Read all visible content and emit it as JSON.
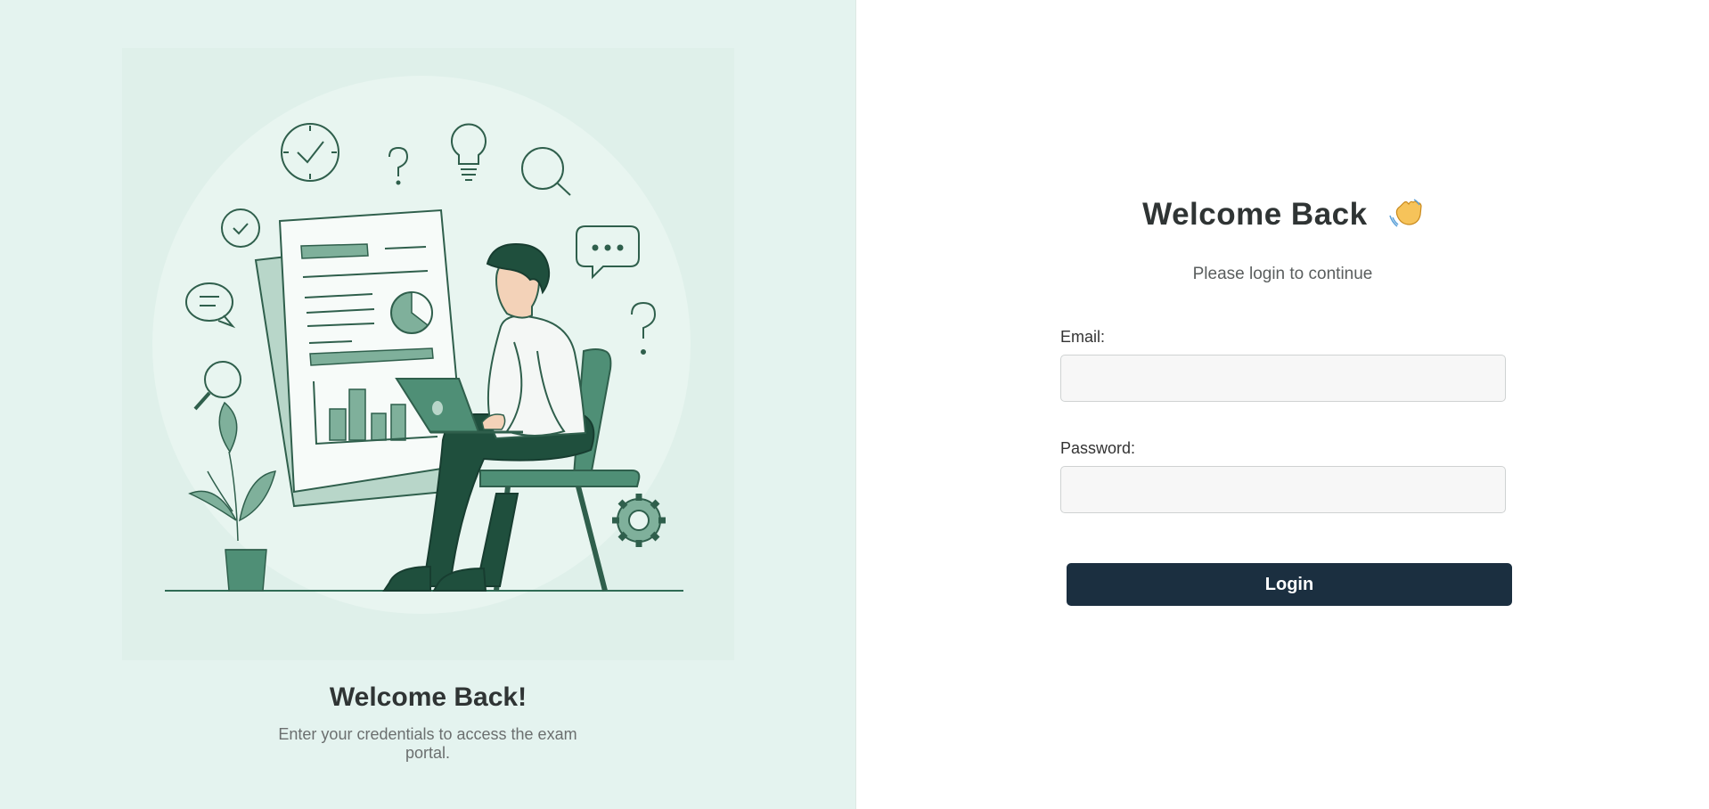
{
  "left": {
    "title": "Welcome Back!",
    "subtitle": "Enter your credentials to access the exam portal."
  },
  "form": {
    "title": "Welcome Back",
    "title_icon": "waving-hand-icon",
    "subtitle": "Please login to continue",
    "email_label": "Email:",
    "email_value": "",
    "password_label": "Password:",
    "password_value": "",
    "login_label": "Login"
  },
  "colors": {
    "left_bg": "#e4f3ef",
    "accent_green": "#4f8f76",
    "dark_green": "#1f4f3d",
    "button_bg": "#1b2f40",
    "input_bg": "#f7f7f7"
  }
}
